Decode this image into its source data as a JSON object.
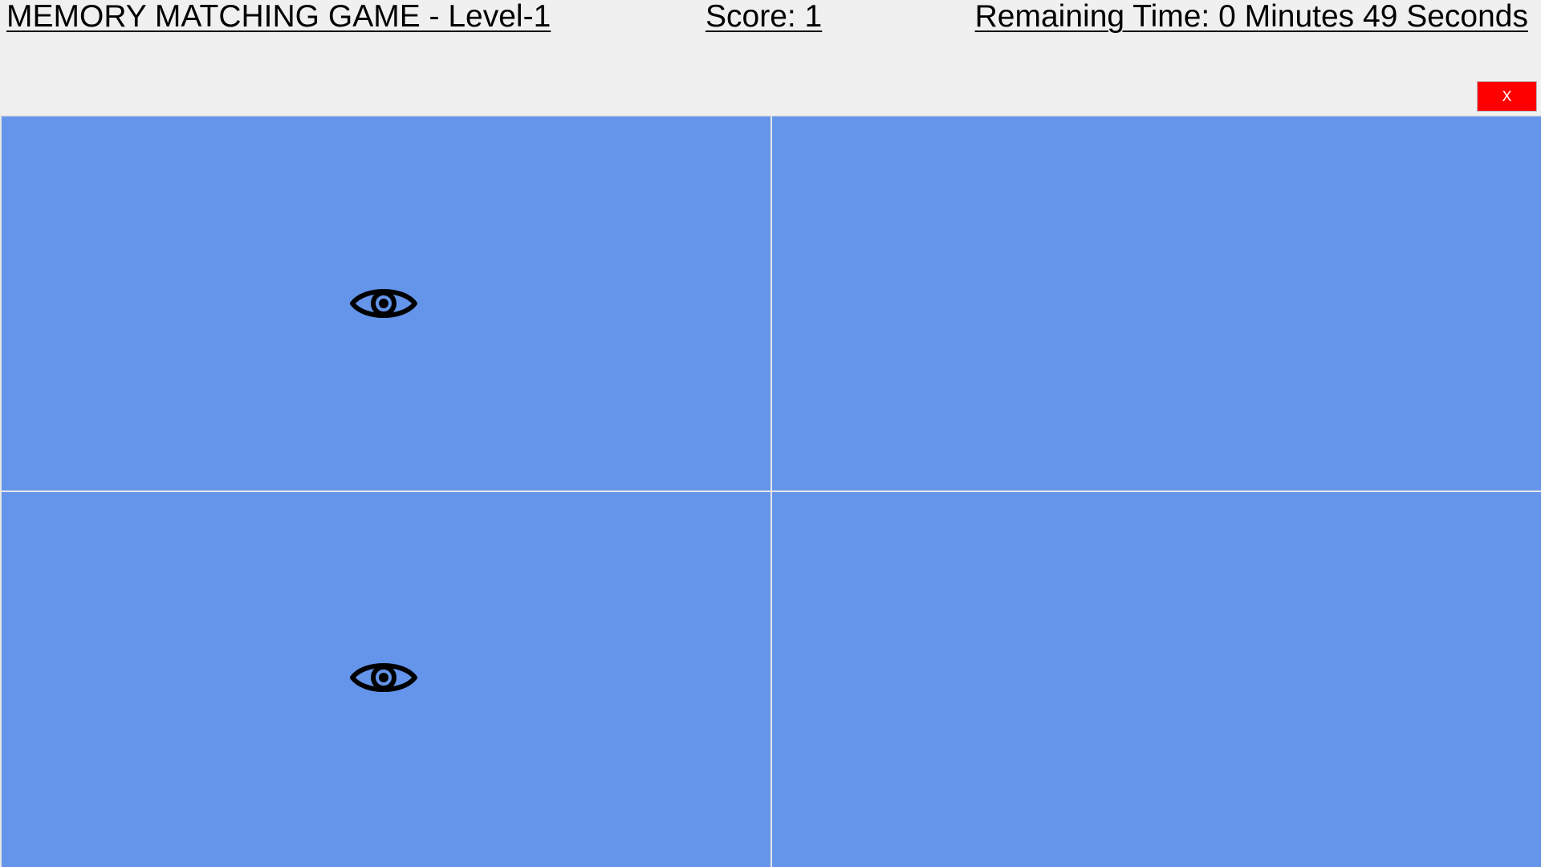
{
  "header": {
    "title": "MEMORY MATCHING GAME - Level-1",
    "score": "Score: 1",
    "remaining_time": "Remaining Time: 0 Minutes 49 Seconds",
    "close_label": "X",
    "close_color": "#ff0000"
  },
  "board": {
    "card_color": "#6495ea",
    "cards": [
      {
        "position": "top-left",
        "face_up": true,
        "icon": "eye-icon"
      },
      {
        "position": "top-right",
        "face_up": false,
        "icon": ""
      },
      {
        "position": "bottom-left",
        "face_up": true,
        "icon": "eye-icon"
      },
      {
        "position": "bottom-right",
        "face_up": false,
        "icon": ""
      }
    ]
  }
}
